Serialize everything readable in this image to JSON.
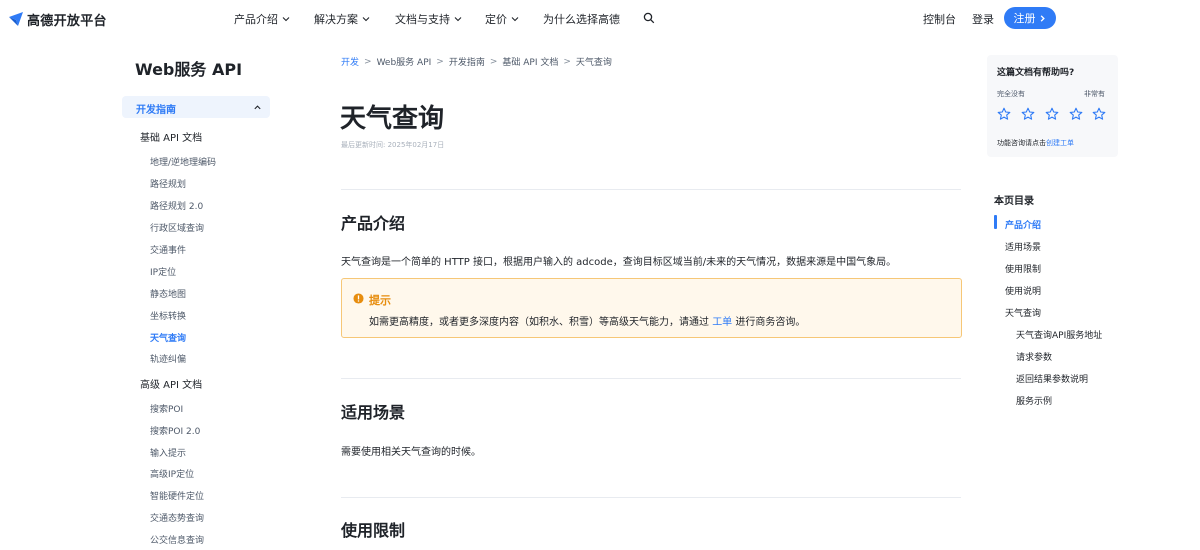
{
  "topnav": {
    "logo_text": "高德开放平台",
    "menu": [
      {
        "label": "产品介绍",
        "has_dropdown": true
      },
      {
        "label": "解决方案",
        "has_dropdown": true
      },
      {
        "label": "文档与支持",
        "has_dropdown": true
      },
      {
        "label": "定价",
        "has_dropdown": true
      },
      {
        "label": "为什么选择高德",
        "has_dropdown": false
      }
    ],
    "console_label": "控制台",
    "login_label": "登录",
    "register_label": "注册"
  },
  "sidebar": {
    "title": "Web服务 API",
    "guide_label": "开发指南",
    "groups": [
      {
        "label": "基础 API 文档",
        "items": [
          "地理/逆地理编码",
          "路径规划",
          "路径规划 2.0",
          "行政区域查询",
          "交通事件",
          "IP定位",
          "静态地图",
          "坐标转换",
          "天气查询",
          "轨迹纠偏"
        ]
      },
      {
        "label": "高级 API 文档",
        "items": [
          "搜索POI",
          "搜索POI 2.0",
          "输入提示",
          "高级IP定位",
          "智能硬件定位",
          "交通态势查询",
          "公交信息查询"
        ]
      }
    ],
    "active_item": "天气查询"
  },
  "breadcrumb": [
    "开发",
    "Web服务 API",
    "开发指南",
    "基础 API 文档",
    "天气查询"
  ],
  "page": {
    "title": "天气查询",
    "updated": "最后更新时间: 2025年02月17日",
    "sections": [
      {
        "heading": "产品介绍",
        "text": "天气查询是一个简单的 HTTP 接口，根据用户输入的 adcode，查询目标区域当前/未来的天气情况，数据来源是中国气象局。"
      },
      {
        "heading": "适用场景",
        "text": "需要使用相关天气查询的时候。"
      },
      {
        "heading": "使用限制",
        "text": ""
      }
    ],
    "tip": {
      "title": "提示",
      "before": "如需更高精度，或者更多深度内容（如积水、积雪）等高级天气能力，请通过",
      "link": "工单",
      "after": "进行商务咨询。"
    }
  },
  "feedback": {
    "title": "这篇文档有帮助吗?",
    "low_label": "完全没有",
    "high_label": "非常有",
    "stars": 5,
    "help_text": "功能咨询请点击",
    "help_link": "创建工单"
  },
  "toc": {
    "title": "本页目录",
    "items": [
      {
        "label": "产品介绍",
        "level": 1,
        "active": true
      },
      {
        "label": "适用场景",
        "level": 1
      },
      {
        "label": "使用限制",
        "level": 1
      },
      {
        "label": "使用说明",
        "level": 1
      },
      {
        "label": "天气查询",
        "level": 1
      },
      {
        "label": "天气查询API服务地址",
        "level": 2
      },
      {
        "label": "请求参数",
        "level": 2
      },
      {
        "label": "返回结果参数说明",
        "level": 2
      },
      {
        "label": "服务示例",
        "level": 2
      }
    ]
  },
  "colors": {
    "accent": "#2f7bf6",
    "tip_bg": "#fff8ec",
    "tip_border": "#f6c777",
    "tip_title": "#e78d0e"
  }
}
